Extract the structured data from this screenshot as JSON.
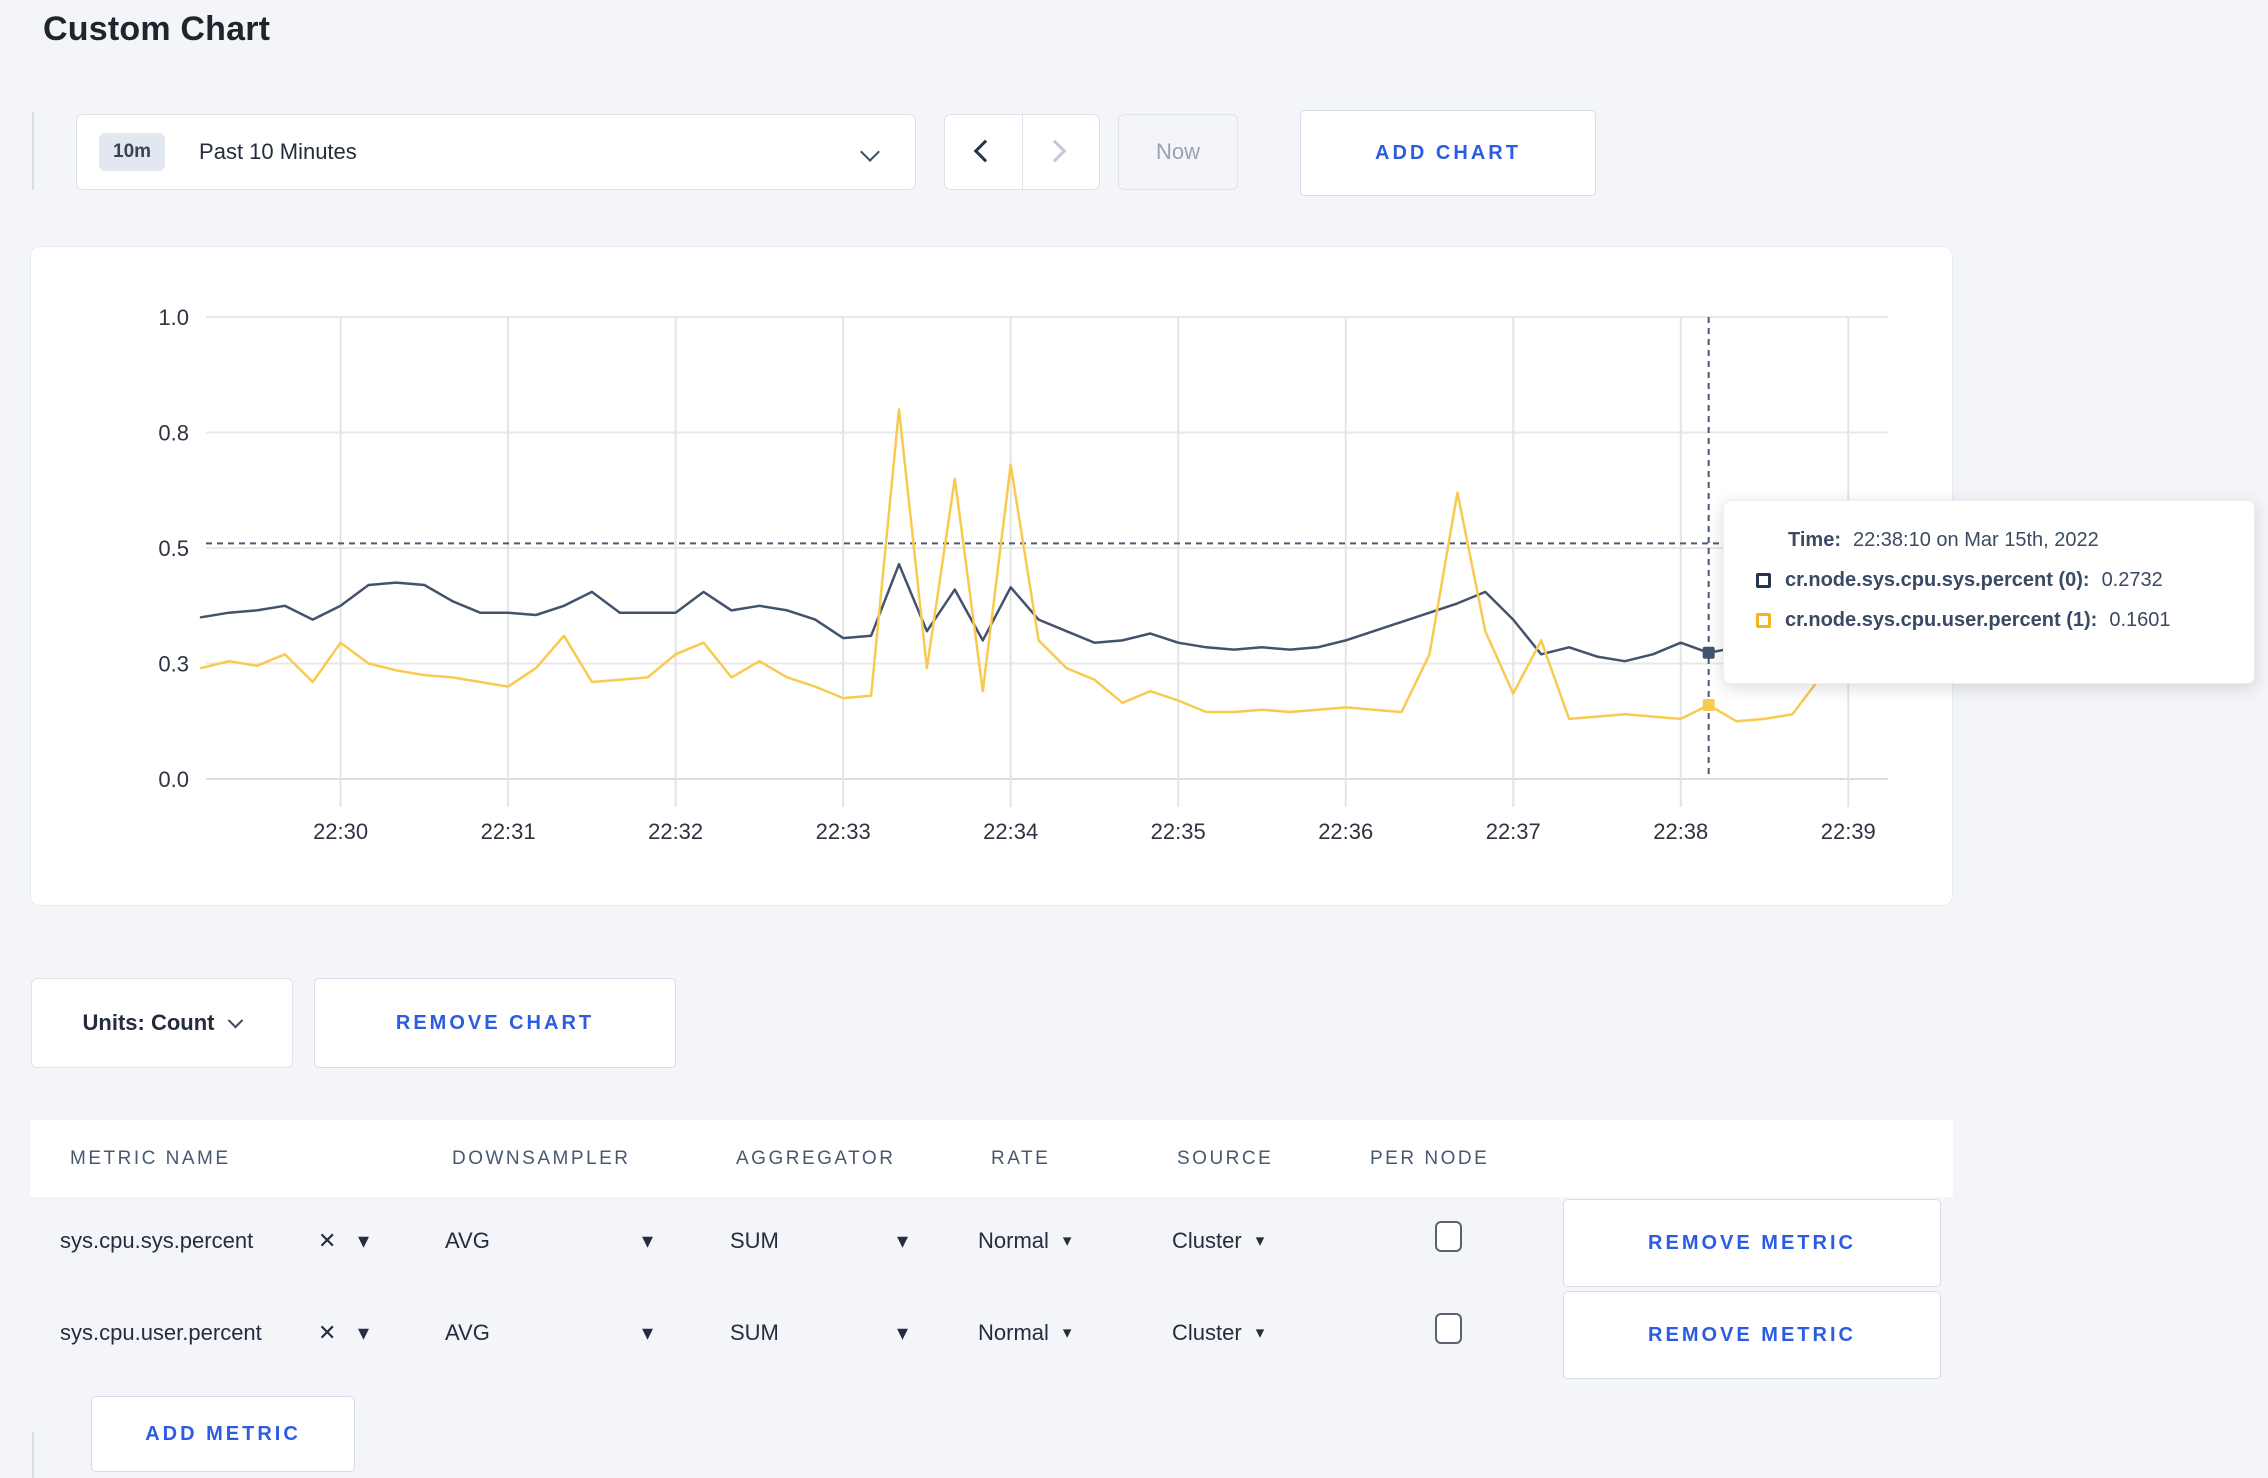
{
  "page": {
    "title": "Custom Chart"
  },
  "colors": {
    "accent_blue": "#2b5ce2",
    "series_sys": "#43526d",
    "series_user": "#f8ca4f",
    "swatch_sys": "#26344e",
    "swatch_user": "#f2b622",
    "grid": "#e8e8e8",
    "axis_text": "#2c3442",
    "crosshair": "#4a5a75"
  },
  "toolbar": {
    "time_selector": {
      "badge": "10m",
      "label": "Past 10 Minutes"
    },
    "now_label": "Now",
    "add_chart_label": "ADD CHART"
  },
  "tooltip": {
    "time_label": "Time:",
    "time_value": "22:38:10 on Mar 15th, 2022",
    "series": [
      {
        "label": "cr.node.sys.cpu.sys.percent (0):",
        "value": "0.2732",
        "color": "#26344e"
      },
      {
        "label": "cr.node.sys.cpu.user.percent (1):",
        "value": "0.1601",
        "color": "#f2b622"
      }
    ]
  },
  "controls": {
    "units_label": "Units: Count",
    "remove_chart_label": "REMOVE CHART"
  },
  "metrics_table": {
    "headers": [
      "METRIC NAME",
      "DOWNSAMPLER",
      "AGGREGATOR",
      "RATE",
      "SOURCE",
      "PER NODE"
    ],
    "rows": [
      {
        "metric": "sys.cpu.sys.percent",
        "downsampler": "AVG",
        "aggregator": "SUM",
        "rate": "Normal",
        "source": "Cluster",
        "per_node_checked": false,
        "remove_label": "REMOVE METRIC"
      },
      {
        "metric": "sys.cpu.user.percent",
        "downsampler": "AVG",
        "aggregator": "SUM",
        "rate": "Normal",
        "source": "Cluster",
        "per_node_checked": false,
        "remove_label": "REMOVE METRIC"
      }
    ],
    "add_metric_label": "ADD METRIC"
  },
  "icons": {
    "caret_down": "▾",
    "close": "✕"
  },
  "chart_data": {
    "type": "line",
    "title": "",
    "xlabel": "",
    "ylabel": "",
    "ylim": [
      0,
      1
    ],
    "grid": true,
    "legend_position": "tooltip",
    "y_ticks": [
      {
        "label": "0.0",
        "v": 0
      },
      {
        "label": "0.3",
        "v": 0.25
      },
      {
        "label": "0.5",
        "v": 0.5
      },
      {
        "label": "0.8",
        "v": 0.75
      },
      {
        "label": "1.0",
        "v": 1
      }
    ],
    "x_ticks": [
      {
        "label": "22:30",
        "i": 5
      },
      {
        "label": "22:31",
        "i": 11
      },
      {
        "label": "22:32",
        "i": 17
      },
      {
        "label": "22:33",
        "i": 23
      },
      {
        "label": "22:34",
        "i": 29
      },
      {
        "label": "22:35",
        "i": 35
      },
      {
        "label": "22:36",
        "i": 41
      },
      {
        "label": "22:37",
        "i": 47
      },
      {
        "label": "22:38",
        "i": 53
      },
      {
        "label": "22:39",
        "i": 59
      }
    ],
    "x": [
      "22:29:10",
      "22:29:20",
      "22:29:30",
      "22:29:40",
      "22:29:50",
      "22:30:00",
      "22:30:10",
      "22:30:20",
      "22:30:30",
      "22:30:40",
      "22:30:50",
      "22:31:00",
      "22:31:10",
      "22:31:20",
      "22:31:30",
      "22:31:40",
      "22:31:50",
      "22:32:00",
      "22:32:10",
      "22:32:20",
      "22:32:30",
      "22:32:40",
      "22:32:50",
      "22:33:00",
      "22:33:10",
      "22:33:20",
      "22:33:30",
      "22:33:40",
      "22:33:50",
      "22:34:00",
      "22:34:10",
      "22:34:20",
      "22:34:30",
      "22:34:40",
      "22:34:50",
      "22:35:00",
      "22:35:10",
      "22:35:20",
      "22:35:30",
      "22:35:40",
      "22:35:50",
      "22:36:00",
      "22:36:10",
      "22:36:20",
      "22:36:30",
      "22:36:40",
      "22:36:50",
      "22:37:00",
      "22:37:10",
      "22:37:20",
      "22:37:30",
      "22:37:40",
      "22:37:50",
      "22:38:00",
      "22:38:10",
      "22:38:20",
      "22:38:30",
      "22:38:40",
      "22:38:50",
      "22:39:00",
      "22:39:10"
    ],
    "series": [
      {
        "name": "cr.node.sys.cpu.sys.percent (0)",
        "color": "#43526d",
        "values": [
          0.35,
          0.36,
          0.365,
          0.375,
          0.345,
          0.375,
          0.42,
          0.425,
          0.42,
          0.385,
          0.36,
          0.36,
          0.355,
          0.375,
          0.405,
          0.36,
          0.36,
          0.36,
          0.405,
          0.365,
          0.375,
          0.365,
          0.345,
          0.305,
          0.31,
          0.465,
          0.32,
          0.41,
          0.3,
          0.415,
          0.345,
          0.32,
          0.295,
          0.3,
          0.315,
          0.295,
          0.285,
          0.28,
          0.285,
          0.28,
          0.285,
          0.3,
          0.32,
          0.34,
          0.36,
          0.38,
          0.405,
          0.345,
          0.27,
          0.285,
          0.265,
          0.255,
          0.27,
          0.295,
          0.2732,
          0.285,
          0.29,
          0.305,
          0.295,
          0.3,
          0.305
        ]
      },
      {
        "name": "cr.node.sys.cpu.user.percent (1)",
        "color": "#f8ca4f",
        "values": [
          0.24,
          0.255,
          0.245,
          0.27,
          0.21,
          0.295,
          0.25,
          0.235,
          0.225,
          0.22,
          0.21,
          0.2,
          0.24,
          0.31,
          0.21,
          0.215,
          0.22,
          0.27,
          0.295,
          0.22,
          0.255,
          0.22,
          0.2,
          0.175,
          0.18,
          0.8,
          0.24,
          0.65,
          0.19,
          0.68,
          0.3,
          0.24,
          0.215,
          0.165,
          0.19,
          0.17,
          0.145,
          0.145,
          0.15,
          0.145,
          0.15,
          0.155,
          0.15,
          0.145,
          0.27,
          0.62,
          0.32,
          0.185,
          0.3,
          0.13,
          0.135,
          0.14,
          0.135,
          0.13,
          0.1601,
          0.125,
          0.13,
          0.14,
          0.22,
          0.295,
          0.23
        ]
      }
    ],
    "crosshair": {
      "x_index": 54,
      "x_label": "22:38:10",
      "y_value": 0.51
    }
  }
}
